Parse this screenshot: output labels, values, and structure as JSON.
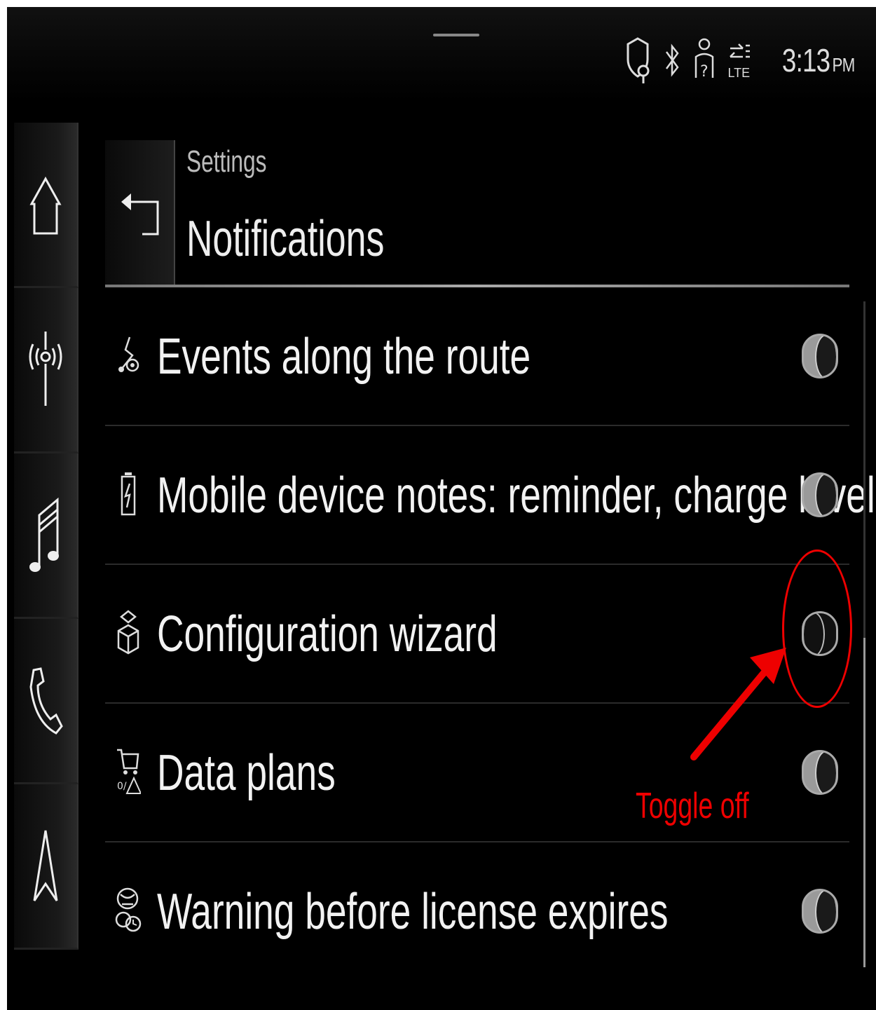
{
  "status_bar": {
    "time": "3:13",
    "ampm": "PM",
    "network_label": "LTE",
    "icons": [
      "shield-location-icon",
      "bluetooth-icon",
      "user-unknown-icon",
      "data-transfer-icon"
    ]
  },
  "side_nav": {
    "items": [
      {
        "icon": "home-icon"
      },
      {
        "icon": "radio-icon"
      },
      {
        "icon": "music-icon"
      },
      {
        "icon": "phone-icon"
      },
      {
        "icon": "navigation-icon"
      }
    ]
  },
  "header": {
    "breadcrumb": "Settings",
    "title": "Notifications",
    "back_icon": "back-arrow-icon"
  },
  "list": {
    "items": [
      {
        "label": "Events along the route",
        "icon": "route-events-icon",
        "enabled": true
      },
      {
        "label": "Mobile device notes: reminder, charge level",
        "icon": "phone-battery-icon",
        "enabled": true
      },
      {
        "label": "Configuration wizard",
        "icon": "wizard-cube-icon",
        "enabled": false
      },
      {
        "label": "Data plans",
        "icon": "cart-warning-icon",
        "enabled": true
      },
      {
        "label": "Warning before license expires",
        "icon": "license-clock-icon",
        "enabled": true
      }
    ]
  },
  "annotation": {
    "text": "Toggle off",
    "color": "#e00000"
  },
  "colors": {
    "background": "#000000",
    "toggle_on": "#9a9a9a",
    "text": "#f2f2f2"
  }
}
